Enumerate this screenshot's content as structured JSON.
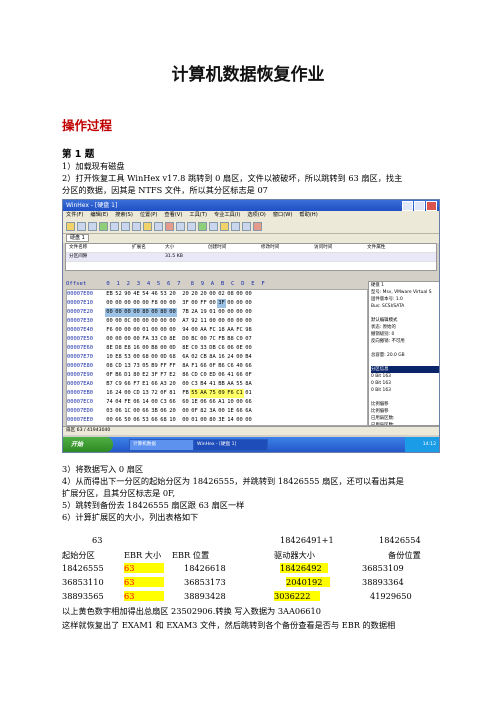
{
  "doc": {
    "title": "计算机数据恢复作业",
    "section": "操作过程",
    "q1": "第 1 题",
    "steps_a": [
      "1）加载现有磁盘",
      "2）打开恢复工具 WinHex v17.8 跳转到 0 扇区，文件以被破坏，所以跳转到 63 扇区，找主",
      "分区的数据，因其是 NTFS 文件，所以其分区标志是 07"
    ],
    "steps_b": [
      "3）将数据写入 0 扇区",
      "4）从而得出下一分区的起始分区为 18426555，并跳转到 18426555 扇区，还可以看出其是",
      "扩展分区，且其分区标志是 0F,",
      "5）跳转到备份去 18426555 扇区跟 63 扇区一样",
      "6）计算扩展区的大小，列出表格如下"
    ],
    "table": {
      "calc_row": [
        "63",
        "18426491+1",
        "18426554"
      ],
      "header": [
        "起始分区",
        "EBR 大小",
        "EBR 位置",
        "驱动器大小",
        "备份位置"
      ],
      "rows": [
        [
          "18426555",
          "63",
          "18426618",
          "18426492",
          "36853109"
        ],
        [
          "36853110",
          "63",
          "36853173",
          "2040192",
          "38893364"
        ],
        [
          "38893565",
          "63",
          "38893428",
          "3036222",
          "41929650"
        ]
      ]
    },
    "after": [
      "以上黄色数字相加得出总扇区    23502906.转换    写入数据为 3AA06610",
      "这样就恢复出了 EXAM1 和 EXAM3 文件，然后跳转到各个备份查看是否与 EBR 的数据相"
    ]
  },
  "screenshot": {
    "window_title": "WinHex - [硬盘 1]",
    "menu": [
      "文件(F)",
      "编辑(E)",
      "搜索(S)",
      "位置(P)",
      "查看(V)",
      "工具(T)",
      "专业工具(I)",
      "选项(O)",
      "窗口(W)",
      "帮助(H)"
    ],
    "tab": "硬盘 1",
    "file_header": [
      "文件名称",
      "扩展名",
      "大小",
      "创建时间",
      "修改时间",
      "访问时间",
      "文件属性"
    ],
    "file_rows": [
      [
        "分区间隙",
        "",
        "31.5 KB",
        "",
        "",
        "",
        ""
      ]
    ],
    "hex_header": "Offset      0  1  2  3  4  5  6  7   8  9  A  B  C  D  E  F",
    "hex_rows": [
      [
        "00007E00",
        [
          "EB",
          "52",
          "90",
          "4E",
          "54",
          "46",
          "53",
          "20",
          "20",
          "20",
          "20",
          "00",
          "02",
          "08",
          "00",
          "00"
        ]
      ],
      [
        "00007E10",
        [
          "00",
          "00",
          "00",
          "00",
          "00",
          "F8",
          "00",
          "00",
          "3F",
          "00",
          "FF",
          "00",
          "3F",
          "00",
          "00",
          "00"
        ]
      ],
      [
        "00007E20",
        [
          "00",
          "00",
          "00",
          "00",
          "80",
          "00",
          "80",
          "00",
          "7B",
          "2A",
          "19",
          "01",
          "00",
          "00",
          "00",
          "00"
        ]
      ],
      [
        "00007E30",
        [
          "00",
          "00",
          "0C",
          "00",
          "00",
          "00",
          "00",
          "00",
          "A7",
          "92",
          "11",
          "00",
          "00",
          "00",
          "00",
          "00"
        ]
      ],
      [
        "00007E40",
        [
          "F6",
          "00",
          "00",
          "00",
          "01",
          "00",
          "00",
          "00",
          "94",
          "00",
          "AA",
          "FC",
          "18",
          "AA",
          "FC",
          "98"
        ]
      ],
      [
        "00007E50",
        [
          "00",
          "00",
          "00",
          "00",
          "FA",
          "33",
          "C0",
          "8E",
          "D0",
          "BC",
          "00",
          "7C",
          "FB",
          "B8",
          "C0",
          "07"
        ]
      ],
      [
        "00007E60",
        [
          "8E",
          "D8",
          "E8",
          "16",
          "00",
          "B8",
          "00",
          "0D",
          "8E",
          "C0",
          "33",
          "DB",
          "C6",
          "06",
          "0E",
          "00"
        ]
      ],
      [
        "00007E70",
        [
          "10",
          "E8",
          "53",
          "00",
          "68",
          "00",
          "0D",
          "68",
          "6A",
          "02",
          "CB",
          "8A",
          "16",
          "24",
          "00",
          "B4"
        ]
      ],
      [
        "00007E80",
        [
          "08",
          "CD",
          "13",
          "73",
          "05",
          "B9",
          "FF",
          "FF",
          "8A",
          "F1",
          "66",
          "0F",
          "B6",
          "C6",
          "40",
          "66"
        ]
      ],
      [
        "00007E90",
        [
          "0F",
          "B6",
          "D1",
          "80",
          "E2",
          "3F",
          "F7",
          "E2",
          "86",
          "CD",
          "C0",
          "ED",
          "06",
          "41",
          "66",
          "0F"
        ]
      ],
      [
        "00007EA0",
        [
          "B7",
          "C9",
          "66",
          "F7",
          "E1",
          "66",
          "A3",
          "20",
          "00",
          "C3",
          "B4",
          "41",
          "BB",
          "AA",
          "55",
          "8A"
        ]
      ],
      [
        "00007EB0",
        [
          "16",
          "24",
          "00",
          "CD",
          "13",
          "72",
          "0F",
          "81",
          "FB",
          "55",
          "AA",
          "75",
          "09",
          "F6",
          "C1",
          "01"
        ]
      ],
      [
        "00007EC0",
        [
          "74",
          "04",
          "FE",
          "06",
          "14",
          "00",
          "C3",
          "66",
          "60",
          "1E",
          "06",
          "66",
          "A1",
          "10",
          "00",
          "66"
        ]
      ],
      [
        "00007ED0",
        [
          "03",
          "06",
          "1C",
          "00",
          "66",
          "3B",
          "06",
          "20",
          "00",
          "0F",
          "82",
          "3A",
          "00",
          "1E",
          "66",
          "6A"
        ]
      ],
      [
        "00007EE0",
        [
          "00",
          "66",
          "50",
          "06",
          "53",
          "66",
          "68",
          "10",
          "00",
          "01",
          "00",
          "80",
          "3E",
          "14",
          "00",
          "00"
        ]
      ]
    ],
    "side_panel": [
      "硬盘 1",
      "型号: Msv, VMware Virtual S",
      "固件版本号:    1.0",
      "Bus:            SCSI/SATA",
      "",
      "默认编辑模式",
      "状态:          原始的",
      "撤销级别:        0",
      "反向撤销:      不可用",
      "",
      "总容量:          20.0 GB",
      "",
      "分区信息",
      "0 Bit 163",
      "0 Bit 163",
      "0 Bit 163",
      "",
      "比例偏移",
      "比例偏移",
      "已用扇区数:",
      "已用扇区数:"
    ],
    "status": "扇区 63 / 41943040",
    "taskbar_start": "开始",
    "taskbar_items": [
      "计算机数据",
      "WinHex - [硬盘 1]"
    ],
    "clock": "14:12"
  }
}
